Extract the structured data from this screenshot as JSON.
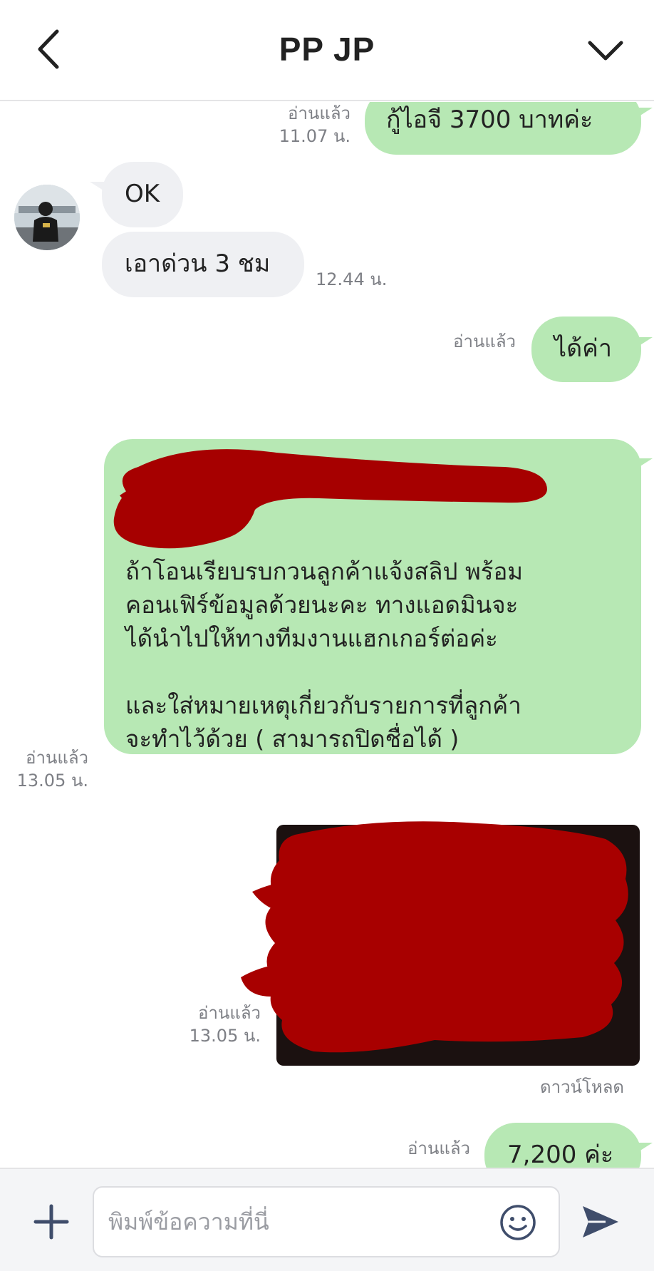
{
  "header": {
    "title": "PP JP",
    "back_icon": "back-arrow-icon",
    "dropdown_icon": "chevron-down-icon"
  },
  "messages": [
    {
      "id": "m1",
      "side": "out",
      "text": "กู้ไอจี 3700 บาทค่ะ",
      "read": "อ่านแล้ว",
      "time": "11.07 น."
    },
    {
      "id": "m2",
      "side": "in",
      "text": "OK"
    },
    {
      "id": "m3",
      "side": "in",
      "text": "เอาด่วน 3 ชม",
      "time": "12.44 น."
    },
    {
      "id": "m4",
      "side": "out",
      "text": "ได้ค่า",
      "read": "อ่านแล้ว"
    },
    {
      "id": "m5",
      "side": "out",
      "text": "ถ้าโอนเรียบรบกวนลูกค้าแจ้งสลิป พร้อม\nคอนเฟิร์ข้อมูลด้วยนะคะ ทางแอดมินจะ\nได้นำไปให้ทางทีมงานแฮกเกอร์ต่อค่ะ\n\nและใส่หมายเหตุเกี่ยวกับรายการที่ลูกค้า\nจะทำไว้ด้วย ( สามารถปิดชื่อได้ )",
      "read": "อ่านแล้ว",
      "time": "13.05 น."
    },
    {
      "id": "m6",
      "side": "out",
      "type": "image",
      "read": "อ่านแล้ว",
      "time": "13.05 น.",
      "download": "ดาวน์โหลด"
    },
    {
      "id": "m7",
      "side": "out",
      "text": "7,200 ค่ะ",
      "read": "อ่านแล้ว"
    }
  ],
  "composer": {
    "placeholder": "พิมพ์ข้อความที่นี่",
    "plus_icon": "plus-icon",
    "emoji_icon": "emoji-icon",
    "send_icon": "send-icon"
  },
  "colors": {
    "outgoing_bubble": "#b7e8b4",
    "incoming_bubble": "#eff0f3",
    "redaction": "#a80000",
    "meta_text": "#7d7f85"
  }
}
